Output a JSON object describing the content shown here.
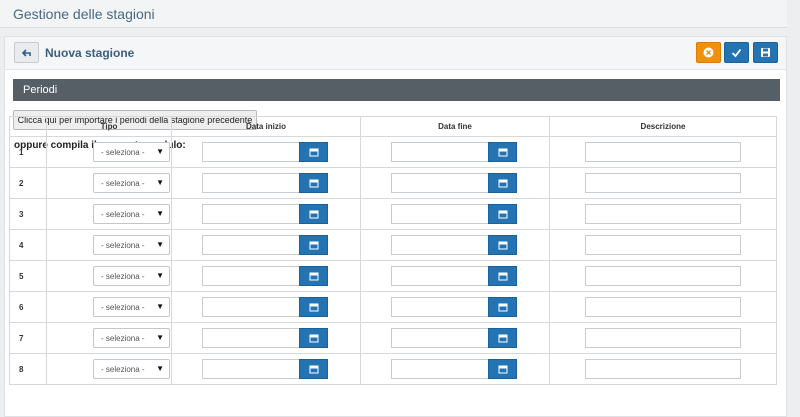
{
  "page": {
    "title": "Gestione delle stagioni"
  },
  "panel": {
    "title": "Nuova stagione",
    "back_icon": "back-arrow-icon",
    "actions": [
      {
        "name": "cancel",
        "icon": "close-circle-icon",
        "color": "#f0900d"
      },
      {
        "name": "confirm",
        "icon": "check-icon",
        "color": "#2474b4"
      },
      {
        "name": "save",
        "icon": "floppy-disk-icon",
        "color": "#2474b4"
      }
    ]
  },
  "section": {
    "title": "Periodi"
  },
  "import_button": {
    "label": "Clicca qui per importare i periodi della stagione precedente"
  },
  "or_label": "oppure compila il seguente modulo:",
  "table": {
    "headers": {
      "tipo": "Tipo",
      "data_inizio": "Data inizio",
      "data_fine": "Data fine",
      "descrizione": "Descrizione"
    },
    "select_placeholder": "- seleziona -",
    "calendar_icon": "calendar-icon",
    "rows": [
      {
        "num": "1"
      },
      {
        "num": "2"
      },
      {
        "num": "3"
      },
      {
        "num": "4"
      },
      {
        "num": "5"
      },
      {
        "num": "6"
      },
      {
        "num": "7"
      },
      {
        "num": "8"
      }
    ]
  }
}
